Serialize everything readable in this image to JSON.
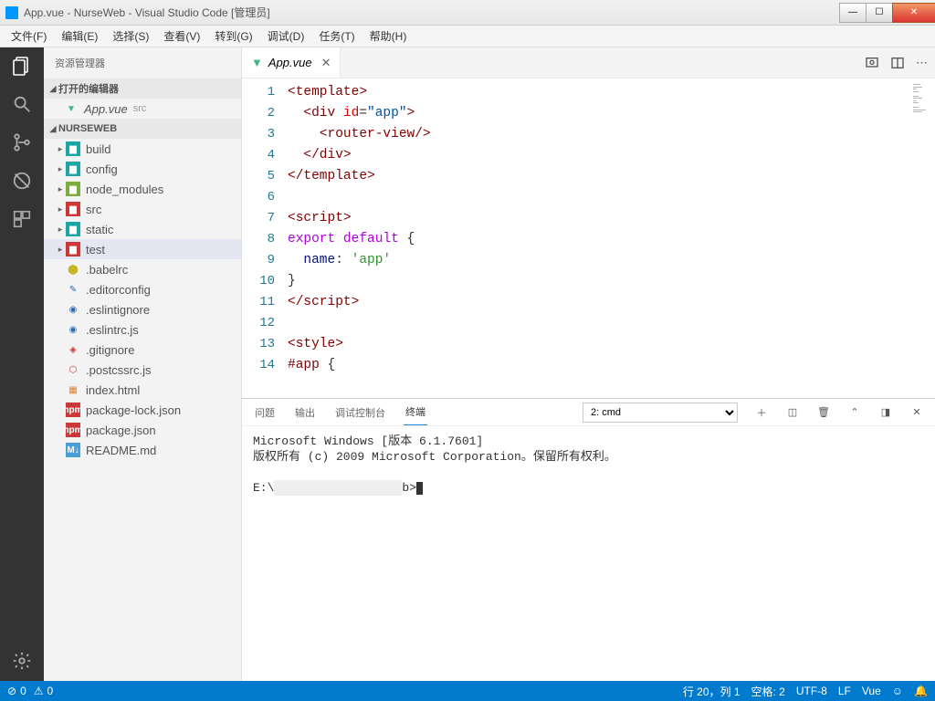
{
  "window": {
    "title": "App.vue - NurseWeb - Visual Studio Code [管理员]"
  },
  "menubar": [
    "文件(F)",
    "编辑(E)",
    "选择(S)",
    "查看(V)",
    "转到(G)",
    "调试(D)",
    "任务(T)",
    "帮助(H)"
  ],
  "sidebar": {
    "title": "资源管理器",
    "open_editors_label": "打开的编辑器",
    "open_editor": {
      "name": "App.vue",
      "hint": "src"
    },
    "project_label": "NURSEWEB",
    "folders": [
      {
        "name": "build",
        "cls": "folder-teal"
      },
      {
        "name": "config",
        "cls": "folder-teal"
      },
      {
        "name": "node_modules",
        "cls": "folder-lime"
      },
      {
        "name": "src",
        "cls": "folder-red"
      },
      {
        "name": "static",
        "cls": "folder-teal"
      },
      {
        "name": "test",
        "cls": "folder-red",
        "selected": true
      }
    ],
    "files": [
      {
        "name": ".babelrc",
        "cls": "file-babel",
        "glyph": "⬤"
      },
      {
        "name": ".editorconfig",
        "cls": "file-blue",
        "glyph": "✎"
      },
      {
        "name": ".eslintignore",
        "cls": "file-blue",
        "glyph": "◉"
      },
      {
        "name": ".eslintrc.js",
        "cls": "file-blue",
        "glyph": "◉"
      },
      {
        "name": ".gitignore",
        "cls": "file-red",
        "glyph": "◈"
      },
      {
        "name": ".postcssrc.js",
        "cls": "file-red",
        "glyph": "⬡"
      },
      {
        "name": "index.html",
        "cls": "file-orange",
        "glyph": "▦"
      },
      {
        "name": "package-lock.json",
        "cls": "file-npm",
        "glyph": "npm"
      },
      {
        "name": "package.json",
        "cls": "file-npm",
        "glyph": "npm"
      },
      {
        "name": "README.md",
        "cls": "file-md",
        "glyph": "M↓"
      }
    ]
  },
  "tab": {
    "name": "App.vue"
  },
  "code": {
    "l1": "<template>",
    "l2a": "<div",
    "l2b": "id",
    "l2c": "\"app\"",
    "l3": "<router-view/>",
    "l4": "</div>",
    "l5": "</template>",
    "l6": "",
    "l7": "<script>",
    "l8a": "export",
    "l8b": "default",
    "l8c": "{",
    "l9a": "name",
    "l9b": "'app'",
    "l10": "}",
    "l11": "</script>",
    "l12": "",
    "l13": "<style>",
    "l14a": "#app",
    "l14b": "{"
  },
  "panel": {
    "tabs": [
      "问题",
      "输出",
      "调试控制台",
      "终端"
    ],
    "select": "2: cmd",
    "line1": "Microsoft Windows [版本 6.1.7601]",
    "line2": "版权所有 (c) 2009 Microsoft Corporation。保留所有权利。",
    "prompt_pre": "E:\\",
    "prompt_post": "b>"
  },
  "statusbar": {
    "errors": "0",
    "warnings": "0",
    "ln": "行 20，列 1",
    "spaces": "空格: 2",
    "enc": "UTF-8",
    "eol": "LF",
    "lang": "Vue"
  }
}
